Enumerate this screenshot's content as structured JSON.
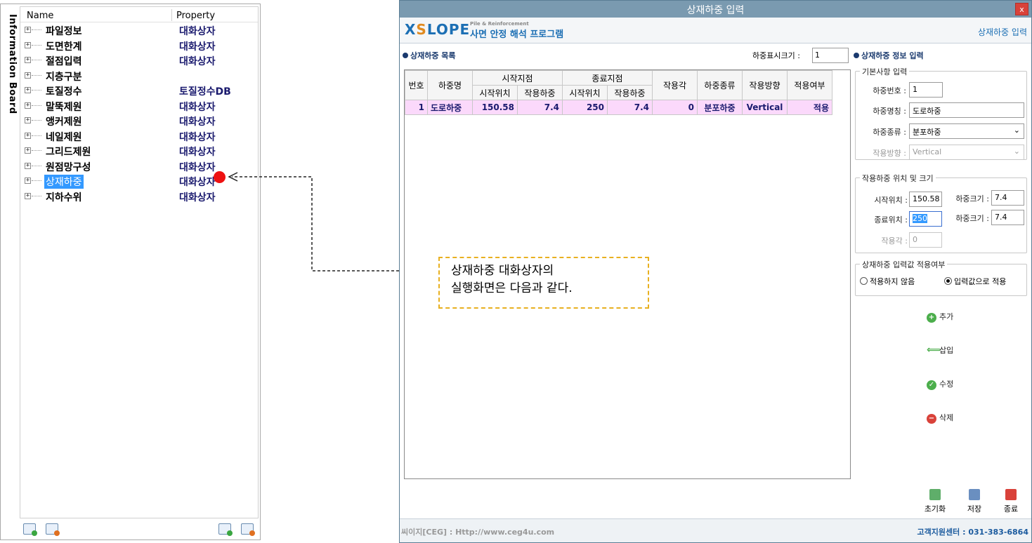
{
  "board": {
    "vertical_title": "Information Board",
    "col_name": "Name",
    "col_property": "Property",
    "items": [
      {
        "name": "파일정보",
        "property": "대화상자"
      },
      {
        "name": "도면한계",
        "property": "대화상자"
      },
      {
        "name": "절점입력",
        "property": "대화상자"
      },
      {
        "name": "지층구분",
        "property": ""
      },
      {
        "name": "토질정수",
        "property": "토질정수DB"
      },
      {
        "name": "말뚝제원",
        "property": "대화상자"
      },
      {
        "name": "앵커제원",
        "property": "대화상자"
      },
      {
        "name": "네일제원",
        "property": "대화상자"
      },
      {
        "name": "그리드제원",
        "property": "대화상자"
      },
      {
        "name": "원점망구성",
        "property": "대화상자"
      },
      {
        "name": "상재하중",
        "property": "대화상자"
      },
      {
        "name": "지하수위",
        "property": "대화상자"
      }
    ],
    "selected_index": 10,
    "expand_glyph": "+",
    "icons": [
      "add-layer-icon",
      "remove-layer-icon",
      "grid-add-icon",
      "grid-remove-icon"
    ]
  },
  "dialog": {
    "title": "상재하중 입력",
    "close_label": "x",
    "logo_x": "X",
    "logo_s": "S",
    "logo_rest": "LOPE",
    "logo_sub": "Pile & Reinforcement",
    "app_name": "사면 안정 해석 프로그램",
    "banner_right": "상재하중 입력",
    "list_title": "상재하중 목록",
    "load_size_label": "하중표시크기 :",
    "load_size_value": "1",
    "info_title": "상재하중 정보 입력"
  },
  "table": {
    "headers": {
      "no": "번호",
      "name": "하중명",
      "start": "시작지점",
      "end": "종료지점",
      "angle": "작용각",
      "type": "하중종류",
      "direction": "작용방향",
      "apply": "적용여부",
      "pos": "시작위치",
      "load": "작용하중",
      "end_pos": "시작위치",
      "end_load": "작용하중"
    },
    "rows": [
      {
        "no": "1",
        "name": "도로하중",
        "start_pos": "150.58",
        "start_load": "7.4",
        "end_pos": "250",
        "end_load": "7.4",
        "angle": "0",
        "type": "분포하중",
        "direction": "Vertical",
        "apply": "적용"
      }
    ]
  },
  "form": {
    "basic_group": "기본사항 입력",
    "load_no_label": "하중번호 :",
    "load_no": "1",
    "load_name_label": "하중명칭 :",
    "load_name": "도로하중",
    "load_type_label": "하중종류 :",
    "load_type": "분포하중",
    "direction_label": "작용방향 :",
    "direction": "Vertical",
    "pos_group": "작용하중 위치 및 크기",
    "start_label": "시작위치 :",
    "start_value": "150.58",
    "start_size_label": "하중크기 :",
    "start_size": "7.4",
    "end_label": "종료위치 :",
    "end_value": "250",
    "end_size_label": "하중크기 :",
    "end_size": "7.4",
    "angle_label": "작용각 :",
    "angle_value": "0",
    "apply_group": "상재하중 입력값 적용여부",
    "radio_no": "적용하지 않음",
    "radio_yes": "입력값으로 적용",
    "radio_selected": "yes"
  },
  "actions": {
    "add": "추가",
    "insert": "삽입",
    "edit": "수정",
    "delete": "삭제",
    "reset": "초기화",
    "save": "저장",
    "exit": "종료"
  },
  "footer": {
    "left": "씨이지[CEG] : Http://www.ceg4u.com",
    "right": "고객지원센터 : 031-383-6864"
  },
  "callout": {
    "line1": "상재하중 대화상자의",
    "line2": "실행화면은 다음과 같다."
  },
  "colors": {
    "row_highlight": "#fbd9fb",
    "selection": "#3399ff",
    "marker": "#ee1111",
    "callout_border": "#e8b020"
  }
}
